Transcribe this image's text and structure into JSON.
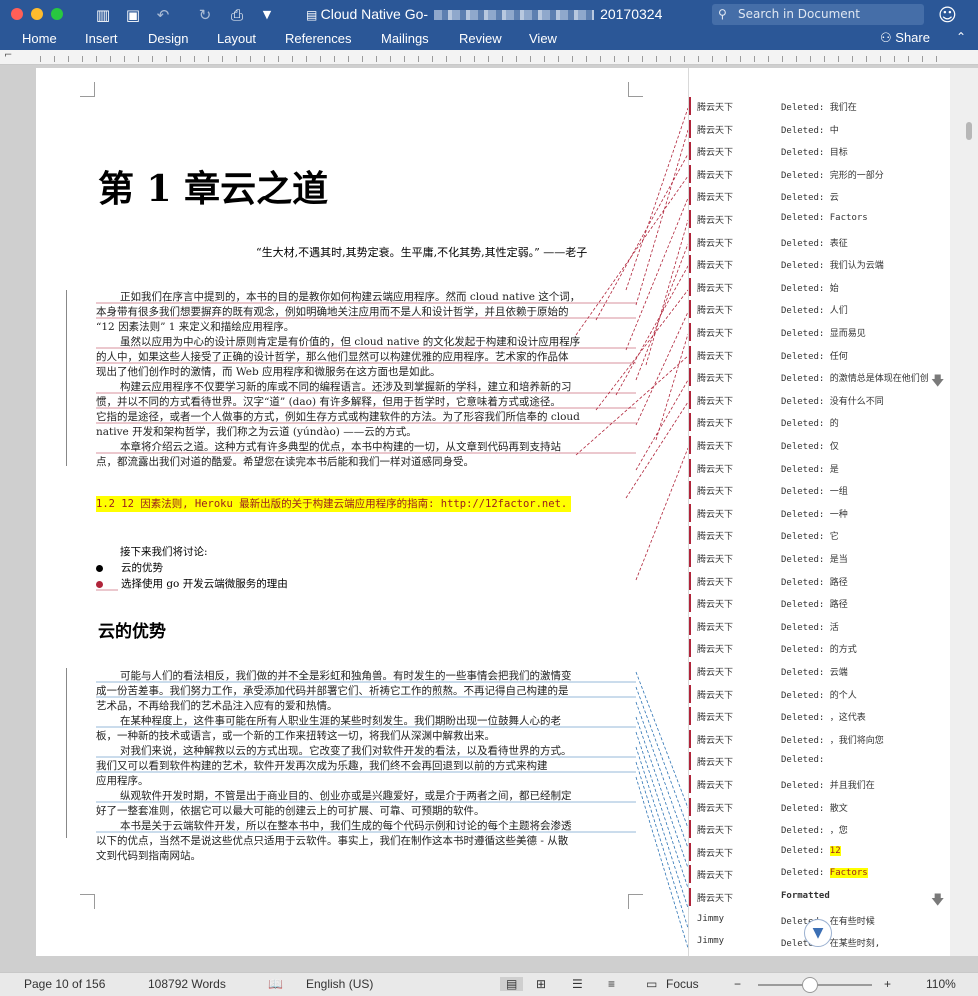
{
  "window": {
    "title_prefix": "Cloud Native Go-",
    "title_suffix": "20170324",
    "search_placeholder": "Search in Document"
  },
  "ribbon": {
    "tabs": [
      "Home",
      "Insert",
      "Design",
      "Layout",
      "References",
      "Mailings",
      "Review",
      "View"
    ],
    "share_label": "Share"
  },
  "document": {
    "chapter_title": "第 1 章云之道",
    "quote": "“生大材,不遇其时,其势定衰。生平庸,不化其势,其性定弱。”  ——老子",
    "paragraphs": [
      [
        "正如我们在序言中提到的，本书的目的是教你如何构建云端应用程序。然而 cloud native 这个词，",
        "本身带有很多我们想要摒弃的既有观念，例如明确地关注应用而不是人和设计哲学，并且依赖于原始的",
        "“12 因素法则” 1 来定义和描绘应用程序。"
      ],
      [
        "虽然以应用为中心的设计原则肯定是有价值的，但 cloud native 的文化发起于构建和设计应用程序",
        "的人中，如果这些人接受了正确的设计哲学，那么他们显然可以构建优雅的应用程序。艺术家的作品体",
        "现出了他们创作时的激情，而 Web 应用程序和微服务在这方面也是如此。"
      ],
      [
        "构建云应用程序不仅要学习新的库或不同的编程语言。还涉及到掌握新的学科，建立和培养新的习",
        "惯，并以不同的方式看待世界。汉字“道” (dao) 有许多解释，但用于哲学时，它意味着方式或途径。",
        "它指的是途径，或者一个人做事的方式，例如生存方式或构建软件的方法。为了形容我们所信奉的 cloud",
        "native 开发和架构哲学，我们称之为云道 (yúndào) ——云的方式。"
      ],
      [
        "本章将介绍云之道。这种方式有许多典型的优点，本书中构建的一切，从文章到代码再到支持站",
        "点，都流露出我们对道的酷爱。希望您在读完本书后能和我们一样对道感同身受。"
      ]
    ],
    "footnote": "1.2  12 因素法则, Heroku 最新出版的关于构建云端应用程序的指南:  http://12factor.net.",
    "list_intro": "接下来我们将讨论:",
    "bullets": [
      "云的优势",
      "选择使用 go 开发云端微服务的理由"
    ],
    "section_title": "云的优势",
    "paragraphs2": [
      [
        "可能与人们的看法相反，我们做的并不全是彩虹和独角兽。有时发生的一些事情会把我们的激情变",
        "成一份苦差事。我们努力工作，承受添加代码并部署它们、祈祷它工作的煎熬。不再记得自己构建的是",
        "艺术品，不再给我们的艺术品注入应有的爱和热情。"
      ],
      [
        "在某种程度上，这件事可能在所有人职业生涯的某些时刻发生。我们期盼出现一位鼓舞人心的老",
        "板，一种新的技术或语言，或一个新的工作来扭转这一切，将我们从深渊中解救出来。"
      ],
      [
        "对我们来说，这种解救以云的方式出现。它改变了我们对软件开发的看法，以及看待世界的方式。",
        "我们又可以看到软件构建的艺术，软件开发再次成为乐趣，我们终不会再回退到以前的方式来构建",
        "应用程序。"
      ],
      [
        "纵观软件开发时期，不管是出于商业目的、创业亦或是兴趣爱好，或是介于两者之间，都已经制定",
        "好了一整套准则，依据它可以最大可能的创建云上的可扩展、可靠、可预期的软件。"
      ],
      [
        "本书是关于云端软件开发，所以在整本书中，我们生成的每个代码示例和讨论的每个主题将会渗透",
        "以下的优点，当然不是说这些优点只适用于云软件。事实上，我们在制作这本书时遵循这些美德 - 从散",
        "文到代码到指南网站。"
      ]
    ]
  },
  "markup": {
    "comments": [
      {
        "author": "腾云天下",
        "text": "Deleted: 我们在"
      },
      {
        "author": "腾云天下",
        "text": "Deleted: 中"
      },
      {
        "author": "腾云天下",
        "text": "Deleted: 目标"
      },
      {
        "author": "腾云天下",
        "text": "Deleted: 完形的一部分"
      },
      {
        "author": "腾云天下",
        "text": "Deleted: 云"
      },
      {
        "author": "腾云天下",
        "text": "Deleted: Factors"
      },
      {
        "author": "腾云天下",
        "text": "Deleted: 表征"
      },
      {
        "author": "腾云天下",
        "text": "Deleted: 我们认为云端"
      },
      {
        "author": "腾云天下",
        "text": "Deleted: 始"
      },
      {
        "author": "腾云天下",
        "text": "Deleted: 人们"
      },
      {
        "author": "腾云天下",
        "text": "Deleted: 显而易见"
      },
      {
        "author": "腾云天下",
        "text": "Deleted: 任何"
      },
      {
        "author": "腾云天下",
        "text": "Deleted: 的激情总是体现在他们创"
      },
      {
        "author": "腾云天下",
        "text": "Deleted: 没有什么不同"
      },
      {
        "author": "腾云天下",
        "text": "Deleted: 的"
      },
      {
        "author": "腾云天下",
        "text": "Deleted: 仅"
      },
      {
        "author": "腾云天下",
        "text": "Deleted: 是"
      },
      {
        "author": "腾云天下",
        "text": "Deleted: 一组"
      },
      {
        "author": "腾云天下",
        "text": "Deleted: 一种"
      },
      {
        "author": "腾云天下",
        "text": "Deleted: 它"
      },
      {
        "author": "腾云天下",
        "text": "Deleted: 是当"
      },
      {
        "author": "腾云天下",
        "text": "Deleted: 路径"
      },
      {
        "author": "腾云天下",
        "text": "Deleted: 路径"
      },
      {
        "author": "腾云天下",
        "text": "Deleted: 活"
      },
      {
        "author": "腾云天下",
        "text": "Deleted: 的方式"
      },
      {
        "author": "腾云天下",
        "text": "Deleted: 云端"
      },
      {
        "author": "腾云天下",
        "text": "Deleted: 的个人"
      },
      {
        "author": "腾云天下",
        "text": "Deleted: ，这代表"
      },
      {
        "author": "腾云天下",
        "text": "Deleted: ，我们将向您"
      },
      {
        "author": "腾云天下",
        "text": "Deleted: "
      },
      {
        "author": "腾云天下",
        "text": "Deleted: 并且我们在"
      },
      {
        "author": "腾云天下",
        "text": "Deleted: 散文"
      },
      {
        "author": "腾云天下",
        "text": "Deleted: ，您"
      },
      {
        "author": "腾云天下",
        "text": "Deleted: ",
        "highlight": "12"
      },
      {
        "author": "腾云天下",
        "text": "Deleted: ",
        "highlight": "Factors"
      },
      {
        "author": "腾云天下",
        "text": "Formatted"
      },
      {
        "author": "Jimmy",
        "text": "Deleted: 在有些时候"
      },
      {
        "author": "Jimmy",
        "text": "Deleted: 在某些时刻,"
      }
    ]
  },
  "status": {
    "page": "Page 10 of 156",
    "words": "108792 Words",
    "language": "English (US)",
    "focus": "Focus",
    "zoom": "110%",
    "zoom_fraction": 0.45
  },
  "colors": {
    "ribbon": "#2b5797",
    "insertion_red": "#b0243a",
    "insertion_blue": "#2e74b5",
    "highlight": "#ffff00"
  }
}
